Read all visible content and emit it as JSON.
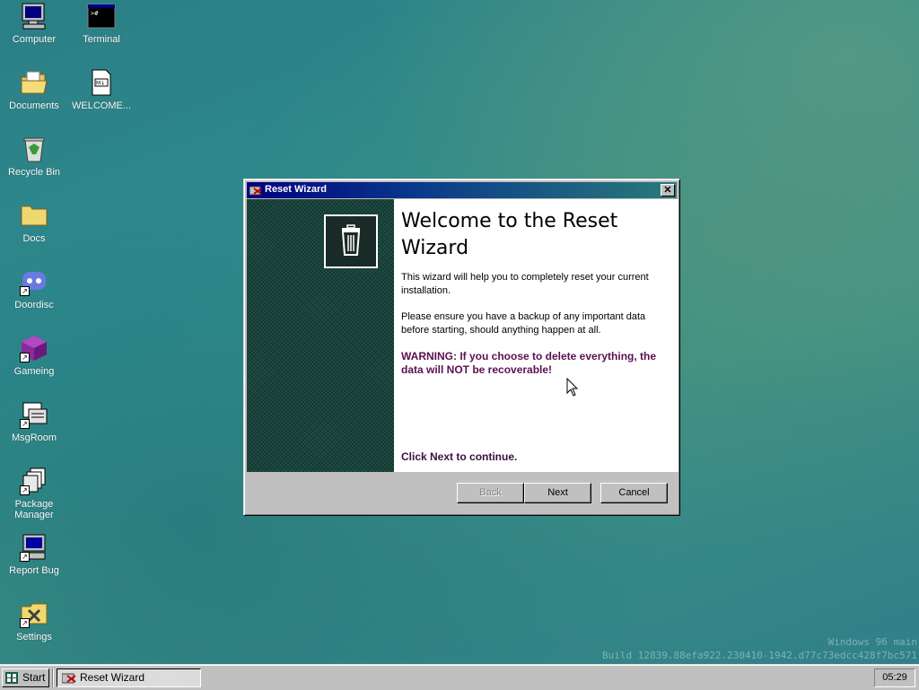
{
  "desktop": {
    "icons": [
      {
        "label": "Computer",
        "icon": "computer-icon"
      },
      {
        "label": "Terminal",
        "icon": "terminal-icon"
      },
      {
        "label": "Documents",
        "icon": "folder-open-icon"
      },
      {
        "label": "WELCOME...",
        "icon": "markdown-file-icon"
      },
      {
        "label": "Recycle Bin",
        "icon": "recycle-bin-icon"
      },
      {
        "label": "Docs",
        "icon": "folder-icon"
      },
      {
        "label": "Doordisc",
        "icon": "chat-app-icon"
      },
      {
        "label": "Gameing",
        "icon": "game-cube-icon"
      },
      {
        "label": "MsgRoom",
        "icon": "message-room-icon"
      },
      {
        "label": "Package Manager",
        "icon": "package-manager-icon"
      },
      {
        "label": "Report Bug",
        "icon": "report-bug-icon"
      },
      {
        "label": "Settings",
        "icon": "settings-icon"
      }
    ],
    "watermark_line1": "Windows 96 main",
    "watermark_line2": "Build 12839.88efa922.230410-1942.d77c73edcc428f7bc571"
  },
  "wizard": {
    "title": "Reset Wizard",
    "close_label": "✕",
    "heading": "Welcome to the Reset Wizard",
    "para1": "This wizard will help you to completely reset your current installation.",
    "para2": "Please ensure you have a backup of any important data before starting, should anything happen at all.",
    "warning": "WARNING: If you choose to delete everything, the data will NOT be recoverable!",
    "continue_text": "Click Next to continue.",
    "back_label": "Back",
    "next_label": "Next",
    "cancel_label": "Cancel"
  },
  "taskbar": {
    "start_label": "Start",
    "task_label": "Reset Wizard",
    "clock": "05:29"
  },
  "colors": {
    "title_start": "#000080",
    "warning_text": "#5a1050",
    "desktop": "#2d8a8c"
  }
}
